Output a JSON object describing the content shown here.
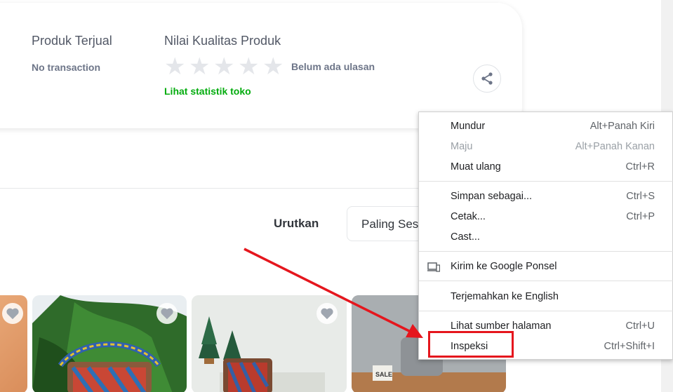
{
  "shop": {
    "sold_label": "Produk Terjual",
    "sold_value": "No transaction",
    "quality_label": "Nilai Kualitas Produk",
    "rating_text": "Belum ada ulasan",
    "stats_link": "Lihat statistik toko",
    "rating_stars": 0,
    "rating_max": 5
  },
  "sort": {
    "label": "Urutkan",
    "selected": "Paling Sesuai"
  },
  "context_menu": {
    "items": [
      {
        "label": "Mundur",
        "shortcut": "Alt+Panah Kiri"
      },
      {
        "label": "Maju",
        "shortcut": "Alt+Panah Kanan"
      },
      {
        "label": "Muat ulang",
        "shortcut": "Ctrl+R"
      },
      {
        "label": "Simpan sebagai...",
        "shortcut": "Ctrl+S"
      },
      {
        "label": "Cetak...",
        "shortcut": "Ctrl+P"
      },
      {
        "label": "Cast..."
      },
      {
        "label": "Kirim ke Google Ponsel"
      },
      {
        "label": "Terjemahkan ke English"
      },
      {
        "label": "Lihat sumber halaman",
        "shortcut": "Ctrl+U"
      },
      {
        "label": "Inspeksi",
        "shortcut": "Ctrl+Shift+I"
      }
    ]
  },
  "product_badge": "SALE",
  "colors": {
    "accent_green": "#03ac0e",
    "annotation_red": "#e5161d"
  }
}
